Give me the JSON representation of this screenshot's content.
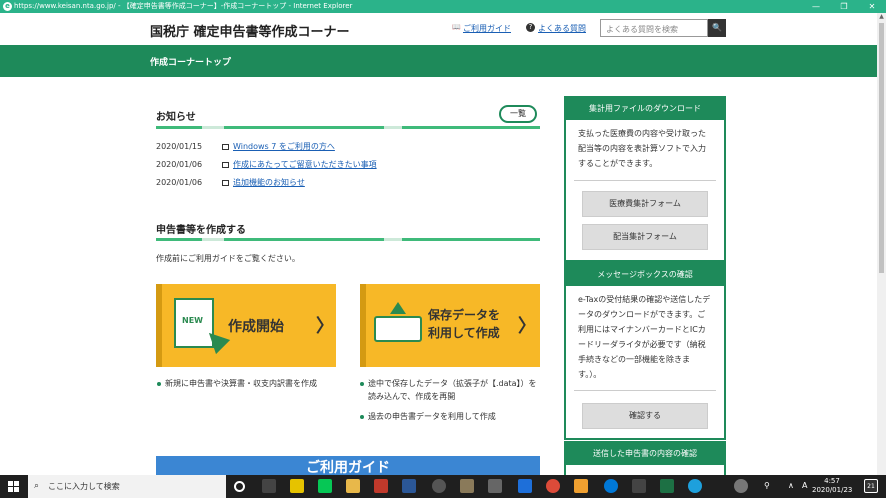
{
  "window": {
    "title": "https://www.keisan.nta.go.jp/ - 【確定申告書等作成コーナー】-作成コーナートップ - Internet Explorer",
    "ie_letter": "e",
    "min": "—",
    "max": "❐",
    "close": "✕"
  },
  "header": {
    "logo": "国税庁 確定申告書等作成コーナー",
    "guide_link": "ご利用ガイド",
    "faq_link": "よくある質問",
    "search_placeholder": "よくある質問を検索",
    "search_icon": "🔍",
    "book_icon": "📖",
    "faq_icon": "?"
  },
  "topbar": {
    "title": "作成コーナートップ"
  },
  "news": {
    "heading": "お知らせ",
    "more_button": "一覧",
    "items": [
      {
        "date": "2020/01/15",
        "text": "Windows 7 をご利用の方へ"
      },
      {
        "date": "2020/01/06",
        "text": "作成にあたってご留意いただきたい事項"
      },
      {
        "date": "2020/01/06",
        "text": "追加機能のお知らせ"
      }
    ]
  },
  "create": {
    "heading": "申告書等を作成する",
    "intro": "作成前にご利用ガイドをご覧ください。",
    "card_new": {
      "badge": "NEW",
      "label": "作成開始",
      "arrow": "〉"
    },
    "card_saved": {
      "line1": "保存データを",
      "line2": "利用して作成",
      "arrow": "〉"
    },
    "bullets_new": [
      "新規に申告書や決算書・収支内訳書を作成"
    ],
    "bullets_saved": [
      "途中で保存したデータ（拡張子が【.data】）を読み込んで、作成を再開",
      "過去の申告書データを利用して作成"
    ]
  },
  "guide_banner": {
    "label": "ご利用ガイド"
  },
  "sidebar": {
    "download": {
      "title": "集計用ファイルのダウンロード",
      "text": "支払った医療費の内容や受け取った配当等の内容を表計算ソフトで入力することができます。",
      "btn1": "医療費集計フォーム",
      "btn2": "配当集計フォーム"
    },
    "messagebox": {
      "title": "メッセージボックスの確認",
      "text": "e-Taxの受付結果の確認や送信したデータのダウンロードができます。ご利用にはマイナンバーカードとICカードリーダライタが必要です（納税手続きなどの一部機能を除きます。）。",
      "btn": "確認する"
    },
    "sent": {
      "title": "送信した申告書の内容の確認"
    }
  },
  "taskbar": {
    "search_placeholder": "ここに入力して検索",
    "time": "4:57",
    "date": "2020/01/23",
    "notif": "21",
    "lang": "A",
    "colors": {
      "bar": "#1f1f1f",
      "accent": "#2bb38a"
    }
  }
}
